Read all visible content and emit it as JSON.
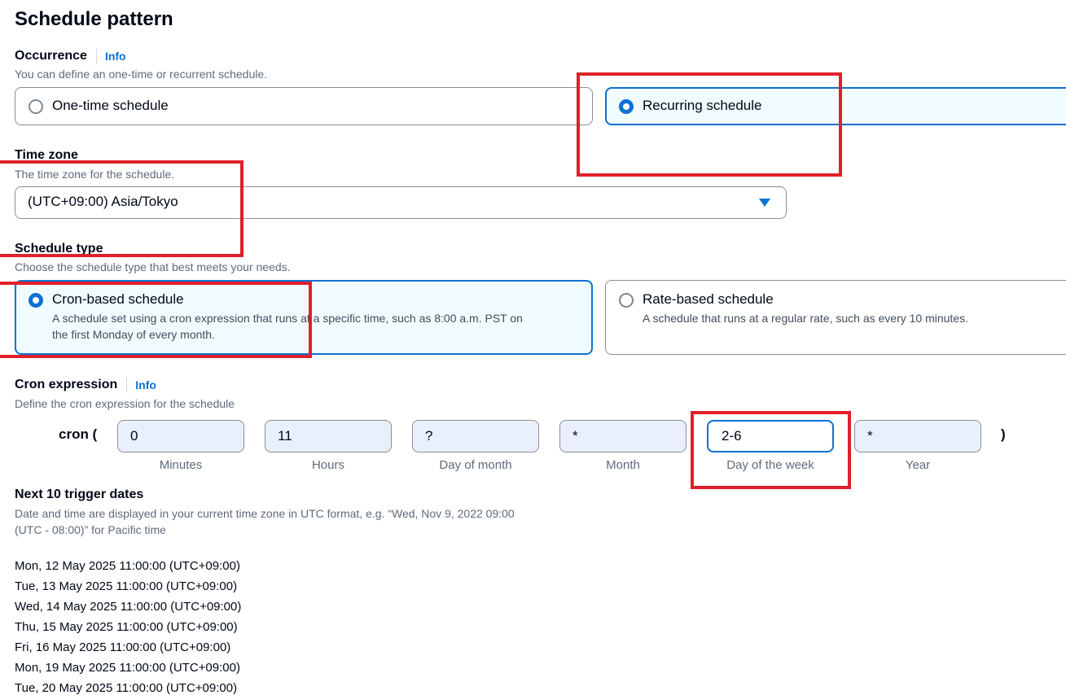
{
  "page": {
    "title": "Schedule pattern"
  },
  "occurrence": {
    "label": "Occurrence",
    "info": "Info",
    "description": "You can define an one-time or recurrent schedule.",
    "options": [
      {
        "label": "One-time schedule",
        "selected": false
      },
      {
        "label": "Recurring schedule",
        "selected": true
      }
    ]
  },
  "timezone": {
    "label": "Time zone",
    "description": "The time zone for the schedule.",
    "value": "(UTC+09:00) Asia/Tokyo"
  },
  "schedule_type": {
    "label": "Schedule type",
    "description": "Choose the schedule type that best meets your needs.",
    "options": [
      {
        "label": "Cron-based schedule",
        "description_line1": "A schedule set using a cron expression that runs at a specific time, such as 8:00 a.m. PST on",
        "description_line2": "the first Monday of every month.",
        "selected": true
      },
      {
        "label": "Rate-based schedule",
        "description": "A schedule that runs at a regular rate, such as every 10 minutes.",
        "selected": false
      }
    ]
  },
  "cron": {
    "label": "Cron expression",
    "info": "Info",
    "description": "Define the cron expression for the schedule",
    "prefix": "cron (",
    "suffix": ")",
    "fields": [
      {
        "caption": "Minutes",
        "value": "0"
      },
      {
        "caption": "Hours",
        "value": "11"
      },
      {
        "caption": "Day of month",
        "value": "?"
      },
      {
        "caption": "Month",
        "value": "*"
      },
      {
        "caption": "Day of the week",
        "value": "2-6"
      },
      {
        "caption": "Year",
        "value": "*"
      }
    ]
  },
  "trigger_dates": {
    "label": "Next 10 trigger dates",
    "description_line1": "Date and time are displayed in your current time zone in UTC format, e.g. “Wed, Nov 9, 2022 09:00",
    "description_line2": "(UTC - 08:00)” for Pacific time",
    "dates": [
      "Mon, 12 May 2025 11:00:00 (UTC+09:00)",
      "Tue, 13 May 2025 11:00:00 (UTC+09:00)",
      "Wed, 14 May 2025 11:00:00 (UTC+09:00)",
      "Thu, 15 May 2025 11:00:00 (UTC+09:00)",
      "Fri, 16 May 2025 11:00:00 (UTC+09:00)",
      "Mon, 19 May 2025 11:00:00 (UTC+09:00)",
      "Tue, 20 May 2025 11:00:00 (UTC+09:00)"
    ]
  },
  "colors": {
    "accent": "#0972d3",
    "highlight_box": "#e0202b",
    "selected_tile_bg": "#f0fbff"
  }
}
